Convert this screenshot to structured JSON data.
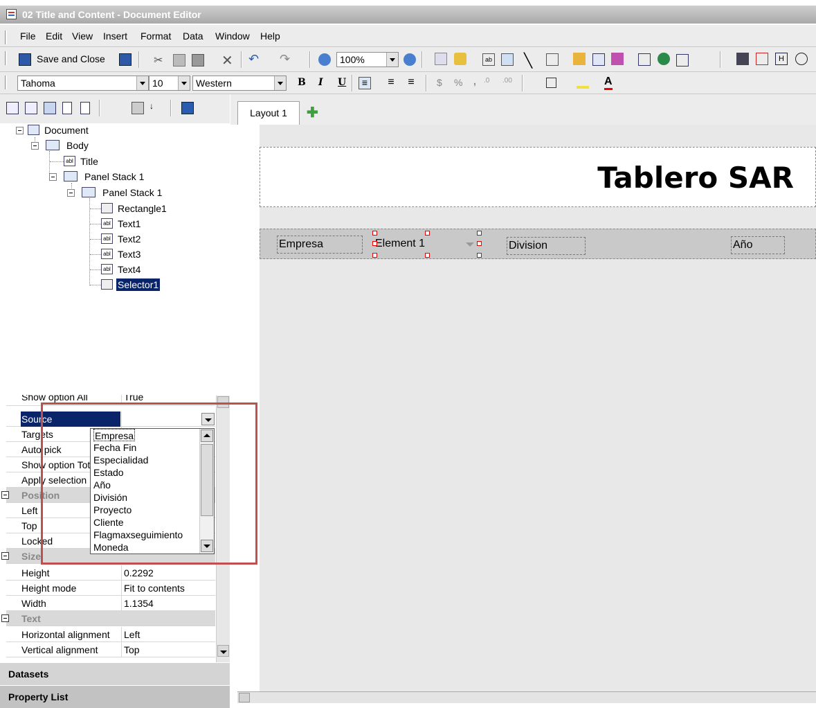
{
  "window": {
    "title": "02 Title and Content - Document Editor"
  },
  "menu": [
    "File",
    "Edit",
    "View",
    "Insert",
    "Format",
    "Data",
    "Window",
    "Help"
  ],
  "toolbar": {
    "save_close": "Save and Close",
    "zoom": "100%"
  },
  "format": {
    "font": "Tahoma",
    "size": "10",
    "charset": "Western",
    "bold": "B",
    "italic": "I",
    "underline": "U",
    "currency": "$",
    "percent": "%",
    "comma": ",",
    "font_color": "A"
  },
  "tree": {
    "document": "Document",
    "body": "Body",
    "title": "Title",
    "panel_stack_outer": "Panel Stack 1",
    "panel_stack_inner": "Panel Stack 1",
    "rectangle": "Rectangle1",
    "text1": "Text1",
    "text2": "Text2",
    "text3": "Text3",
    "text4": "Text4",
    "selector": "Selector1"
  },
  "props": {
    "show_option_all": {
      "k": "Show option All",
      "v": "True"
    },
    "source": {
      "k": "Source",
      "v": ""
    },
    "targets": {
      "k": "Targets"
    },
    "auto_pick": {
      "k": "Auto pick"
    },
    "show_option_total": {
      "k": "Show option Total"
    },
    "apply_selection": {
      "k": "Apply selection"
    },
    "cat_position": "Position",
    "left": {
      "k": "Left"
    },
    "top": {
      "k": "Top"
    },
    "locked": {
      "k": "Locked"
    },
    "cat_size": "Size",
    "height": {
      "k": "Height",
      "v": "0.2292"
    },
    "height_mode": {
      "k": "Height mode",
      "v": "Fit to contents"
    },
    "width": {
      "k": "Width",
      "v": "1.1354"
    },
    "cat_text": "Text",
    "halign": {
      "k": "Horizontal alignment",
      "v": "Left"
    },
    "valign": {
      "k": "Vertical alignment",
      "v": "Top"
    }
  },
  "source_options": [
    "Empresa",
    "Fecha Fin",
    "Especialidad",
    "Estado",
    "Año",
    "División",
    "Proyecto",
    "Cliente",
    "Flagmaxseguimiento",
    "Moneda"
  ],
  "sections": {
    "datasets": "Datasets",
    "property_list": "Property List"
  },
  "canvas": {
    "tab": "Layout 1",
    "title": "Tablero SAR",
    "filters": {
      "empresa": "Empresa",
      "element": "Element 1",
      "division": "Division",
      "anio": "Año"
    }
  },
  "colors": {
    "highlight": "#0a246a",
    "annotation": "#c0504d",
    "titlebar": "#b5b5b5"
  }
}
